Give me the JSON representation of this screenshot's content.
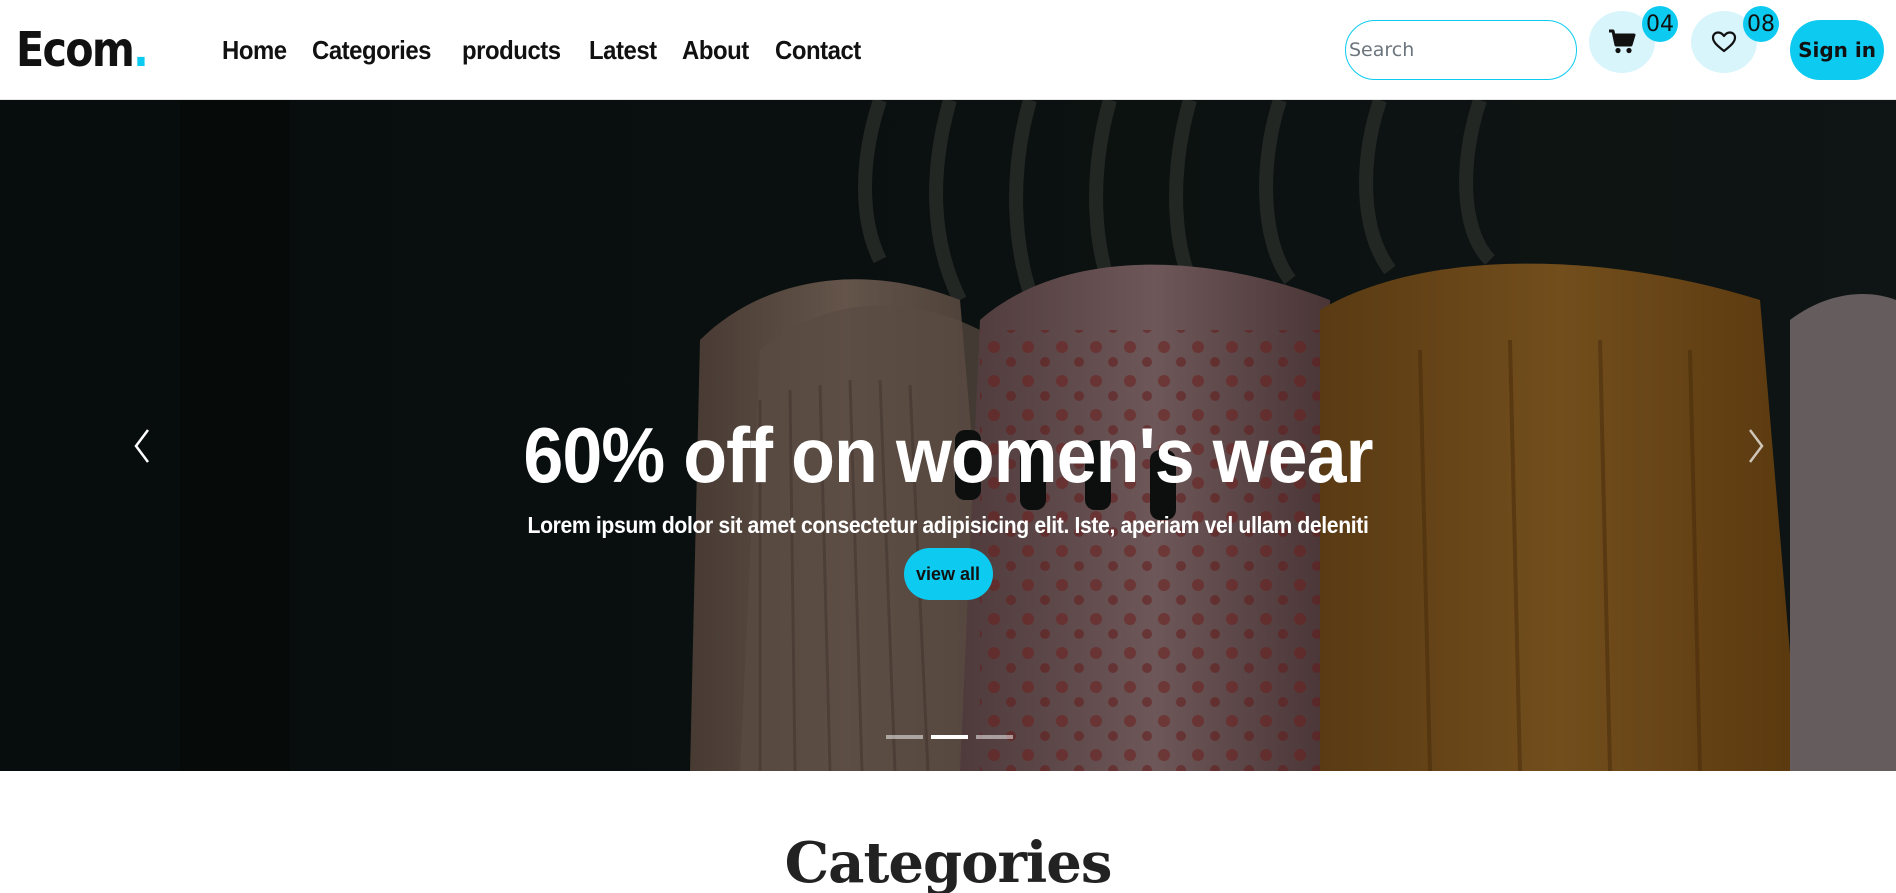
{
  "brand": {
    "name": "Ecom",
    "dot": "."
  },
  "nav": {
    "links": [
      "Home",
      "Categories",
      "products",
      "Latest",
      "About",
      "Contact"
    ]
  },
  "search": {
    "placeholder": "Search",
    "value": ""
  },
  "cart": {
    "icon": "cart-icon",
    "count": "04"
  },
  "wishlist": {
    "icon": "heart-icon",
    "count": "08"
  },
  "signin": {
    "label": "Sign in"
  },
  "hero": {
    "title": "60% off on women's wear",
    "subtitle": "Lorem ipsum dolor sit amet consectetur adipisicing elit. Iste, aperiam vel ullam deleniti",
    "button_label": "view all",
    "prev_icon": "chevron-left-icon",
    "next_icon": "chevron-right-icon",
    "slides": 3,
    "active_slide": 2
  },
  "categories_section": {
    "title": "Categories"
  },
  "colors": {
    "accent": "#0dcaf0",
    "accent_light": "#d8f5fc",
    "text": "#111111"
  }
}
